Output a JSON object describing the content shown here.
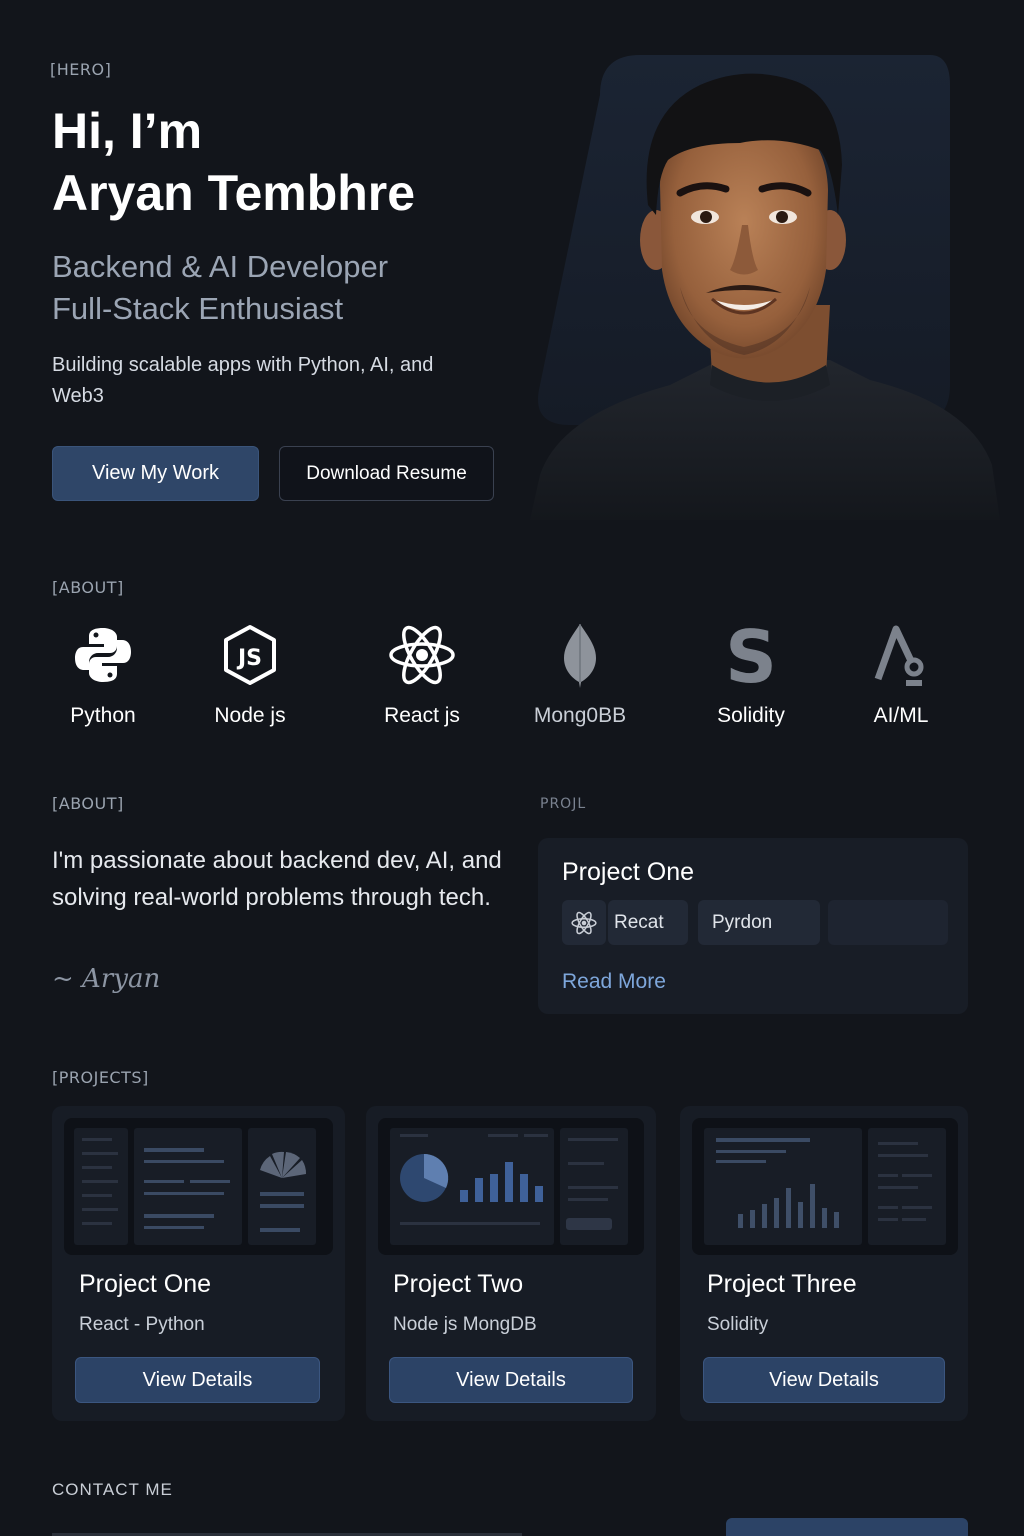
{
  "colors": {
    "background": "#12151b",
    "card": "#171c25",
    "accent_button": "#2f4668",
    "link": "#7ea7db",
    "muted_text": "#9ba5b4"
  },
  "hero": {
    "tag": "[HERO]",
    "title_line1": "Hi, I’m",
    "title_line2": "Aryan Tembhre",
    "role_line1": "Backend & AI Developer",
    "role_line2": "Full-Stack Enthusiast",
    "description": "Building scalable apps with Python, AI, and Web3",
    "primary_button": "View My Work",
    "secondary_button": "Download Resume"
  },
  "skills": {
    "tag": "[ABOUT]",
    "items": [
      {
        "label": "Python",
        "icon": "python-icon"
      },
      {
        "label": "Node js",
        "icon": "nodejs-icon"
      },
      {
        "label": "React js",
        "icon": "react-icon"
      },
      {
        "label": "Mong0BB",
        "icon": "mongodb-leaf-icon"
      },
      {
        "label": "Solidity",
        "icon": "solidity-icon"
      },
      {
        "label": "AI/ML",
        "icon": "ai-ml-icon"
      }
    ]
  },
  "about": {
    "tag": "[ABOUT]",
    "text": "I'm passionate about backend dev, AI, and solving real-world problems through tech.",
    "signature": "~ Aryan"
  },
  "projects_preview": {
    "tag": "PROJL",
    "title": "Project One",
    "chips": [
      "Recat",
      "Pyrdon"
    ],
    "read_more": "Read More"
  },
  "projects": {
    "tag": "[PROJECTS]",
    "items": [
      {
        "title": "Project One",
        "tech": "React - Python",
        "button": "View Details"
      },
      {
        "title": "Project Two",
        "tech": "Node js  MongDB",
        "button": "View Details"
      },
      {
        "title": "Project Three",
        "tech": "Solidity",
        "button": "View Details"
      }
    ]
  },
  "contact": {
    "tag": "CONTACT ME"
  }
}
